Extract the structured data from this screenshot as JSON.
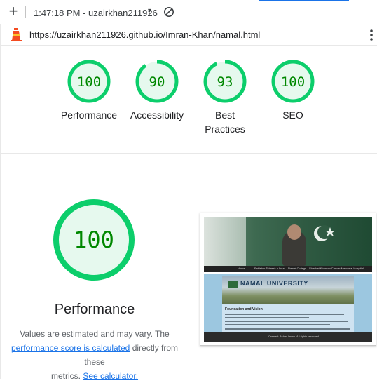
{
  "toolbar": {
    "new_label": "+",
    "session": "1:47:18 PM - uzairkhan211926",
    "caret": "▾"
  },
  "address": {
    "url": "https://uzairkhan211926.github.io/Imran-Khan/namal.html"
  },
  "scores": [
    {
      "label": "Performance",
      "value": "100",
      "score": 100
    },
    {
      "label": "Accessibility",
      "value": "90",
      "score": 90
    },
    {
      "label": "Best Practices",
      "value": "93",
      "score": 93
    },
    {
      "label": "SEO",
      "value": "100",
      "score": 100
    }
  ],
  "performance": {
    "value": "100",
    "score": 100,
    "title": "Performance",
    "note_line1": "Values are estimated and may vary. The",
    "link1": "performance score is calculated",
    "note_line2_tail": "directly from these",
    "note_line3_head": "metrics.",
    "link2": "See calculator."
  },
  "screenshot": {
    "logo_text": "NAMAL UNIVERSITY",
    "section_heading": "Foundation and Vision",
    "nav_items": [
      "Home",
      "Pakistan Tehreek e Insaf",
      "Namal College",
      "Shaukat Khanum Cancer Memorial Hospital"
    ],
    "footer_text": "Created: Asher Imran. All rights reserved."
  },
  "colors": {
    "pass": "#0cce6b",
    "pass_fill": "#e6f9ee",
    "pass_text": "#008800",
    "accent": "#1a73e8"
  }
}
